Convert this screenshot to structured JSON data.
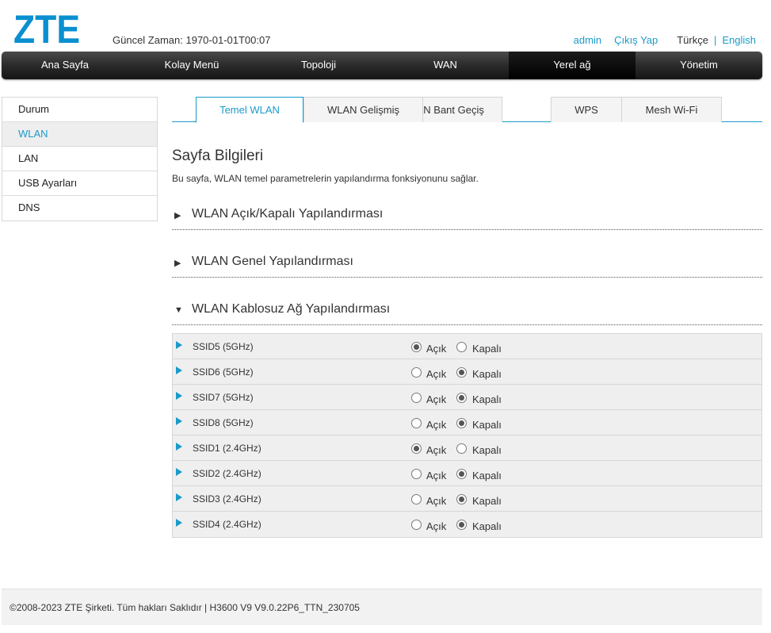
{
  "header": {
    "logo_text": "ZTE",
    "time_label": "Güncel Zaman: 1970-01-01T00:07",
    "user": "admin",
    "logout": "Çıkış Yap",
    "lang_current": "Türkçe",
    "lang_separator": "|",
    "lang_other": "English"
  },
  "nav": [
    {
      "label": "Ana Sayfa"
    },
    {
      "label": "Kolay Menü"
    },
    {
      "label": "Topoloji"
    },
    {
      "label": "WAN"
    },
    {
      "label": "Yerel ağ"
    },
    {
      "label": "Yönetim"
    }
  ],
  "sidebar": [
    {
      "label": "Durum"
    },
    {
      "label": "WLAN"
    },
    {
      "label": "LAN"
    },
    {
      "label": "USB Ayarları"
    },
    {
      "label": "DNS"
    }
  ],
  "tabs": [
    {
      "label": "Temel WLAN"
    },
    {
      "label": "WLAN Gelişmiş"
    },
    {
      "label": "WLAN Bant Geçiş"
    },
    {
      "label": "WPS"
    },
    {
      "label": "Mesh Wi-Fi"
    }
  ],
  "page": {
    "title": "Sayfa Bilgileri",
    "description": "Bu sayfa, WLAN temel parametrelerin yapılandırma fonksiyonunu sağlar."
  },
  "sections": [
    {
      "label": "WLAN Açık/Kapalı Yapılandırması",
      "expanded": false
    },
    {
      "label": "WLAN Genel Yapılandırması",
      "expanded": false
    },
    {
      "label": "WLAN Kablosuz Ağ Yapılandırması",
      "expanded": true
    }
  ],
  "radio_labels": {
    "on": "Açık",
    "off": "Kapalı"
  },
  "ssids": [
    {
      "name": "SSID5 (5GHz)",
      "enabled": true
    },
    {
      "name": "SSID6 (5GHz)",
      "enabled": false
    },
    {
      "name": "SSID7 (5GHz)",
      "enabled": false
    },
    {
      "name": "SSID8 (5GHz)",
      "enabled": false
    },
    {
      "name": "SSID1 (2.4GHz)",
      "enabled": true
    },
    {
      "name": "SSID2 (2.4GHz)",
      "enabled": false
    },
    {
      "name": "SSID3 (2.4GHz)",
      "enabled": false
    },
    {
      "name": "SSID4 (2.4GHz)",
      "enabled": false
    }
  ],
  "footer": {
    "text": "©2008-2023 ZTE Şirketi. Tüm hakları Saklıdır  |   H3600 V9 V9.0.22P6_TTN_230705"
  },
  "colors": {
    "accent": "#1a9bc9",
    "brand": "#0087c3"
  }
}
